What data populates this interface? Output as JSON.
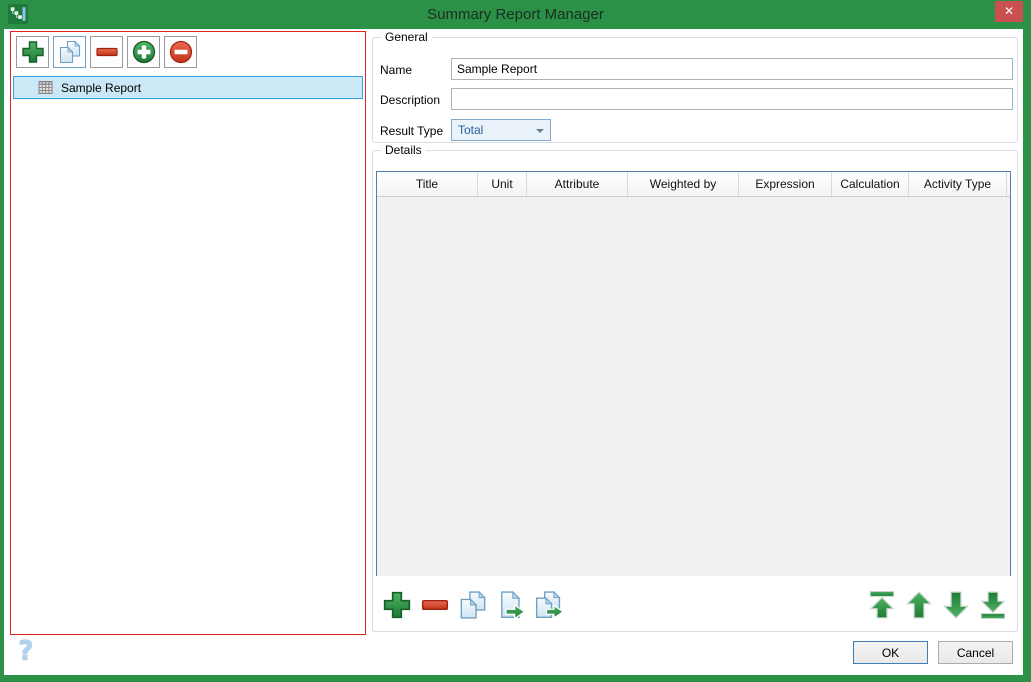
{
  "titlebar": {
    "title": "Summary Report Manager",
    "close_glyph": "✕"
  },
  "left_panel": {
    "toolbar_icons": [
      "add-icon",
      "copy-icon",
      "remove-icon",
      "circle-add-icon",
      "circle-remove-icon"
    ],
    "reports": [
      {
        "label": "Sample Report",
        "icon": "table-icon",
        "selected": true
      }
    ]
  },
  "general": {
    "legend": "General",
    "name_label": "Name",
    "name_value": "Sample Report",
    "description_label": "Description",
    "description_value": "",
    "result_type_label": "Result Type",
    "result_type_value": "Total"
  },
  "details": {
    "legend": "Details",
    "columns": [
      "Title",
      "Unit",
      "Attribute",
      "Weighted by",
      "Expression",
      "Calculation",
      "Activity Type"
    ],
    "rows": [],
    "toolbar_icons": [
      "add-icon",
      "remove-icon",
      "copy-icon",
      "import-icon",
      "export-icon"
    ],
    "reorder_icons": [
      "move-first-icon",
      "move-up-icon",
      "move-down-icon",
      "move-last-icon"
    ]
  },
  "footer": {
    "help_glyph": "?",
    "ok_label": "OK",
    "cancel_label": "Cancel"
  },
  "colors": {
    "frame_green": "#2B9147",
    "close_button_red": "#C9504E",
    "selection_bg": "#CBE8F6",
    "selection_border": "#35A3DC",
    "left_panel_border": "#E0241B",
    "grid_border_blue": "#4E7EAE",
    "grid_body_gray": "#F1F1F1",
    "combo_bg": "#EAF2FA",
    "combo_border": "#84ABCF",
    "combo_text": "#2C5E9E",
    "ok_border": "#3F7FB6",
    "icon_green": "#1C7B33",
    "icon_red": "#C53317"
  }
}
